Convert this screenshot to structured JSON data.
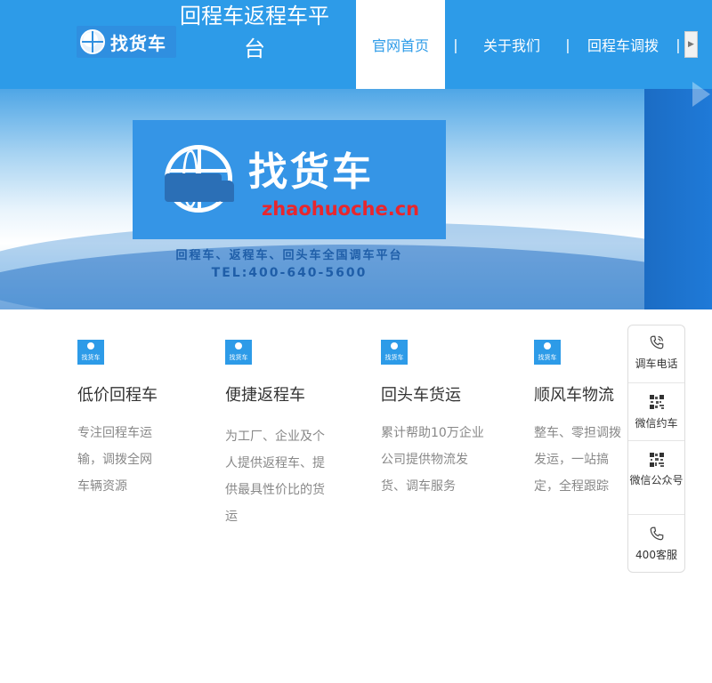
{
  "header": {
    "logo_text": "找货车",
    "site_title": "回程车返程车平台",
    "nav": [
      {
        "label": "官网首页"
      },
      {
        "label": "关于我们"
      },
      {
        "label": "回程车调拨"
      }
    ],
    "nav_separator": "|"
  },
  "banner": {
    "brand": "找货车",
    "domain": "zhaohuoche.cn",
    "slogan": "回程车、返程车、回头车全国调车平台",
    "tel": "TEL:400-640-5600"
  },
  "features": [
    {
      "icon_text": "找货车",
      "title": "低价回程车",
      "desc": "专注回程车运输，调拨全网车辆资源"
    },
    {
      "icon_text": "找货车",
      "title": "便捷返程车",
      "desc": "为工厂、企业及个人提供返程车、提供最具性价比的货运"
    },
    {
      "icon_text": "找货车",
      "title": "回头车货运",
      "desc": "累计帮助10万企业公司提供物流发货、调车服务"
    },
    {
      "icon_text": "找货车",
      "title": "顺风车物流",
      "desc": "整车、零担调拨发运，一站搞定，全程跟踪"
    }
  ],
  "side_float": [
    {
      "label": "调车电话",
      "icon": "phone-ringing-icon"
    },
    {
      "label": "微信约车",
      "icon": "qr-code-icon"
    },
    {
      "label": "微信公众号",
      "icon": "qr-code-icon"
    },
    {
      "label": "400客服",
      "icon": "phone-icon"
    }
  ],
  "colors": {
    "primary": "#2d9be8",
    "card": "#3595e6",
    "domain_red": "#e8262d",
    "text_gray": "#888888"
  }
}
